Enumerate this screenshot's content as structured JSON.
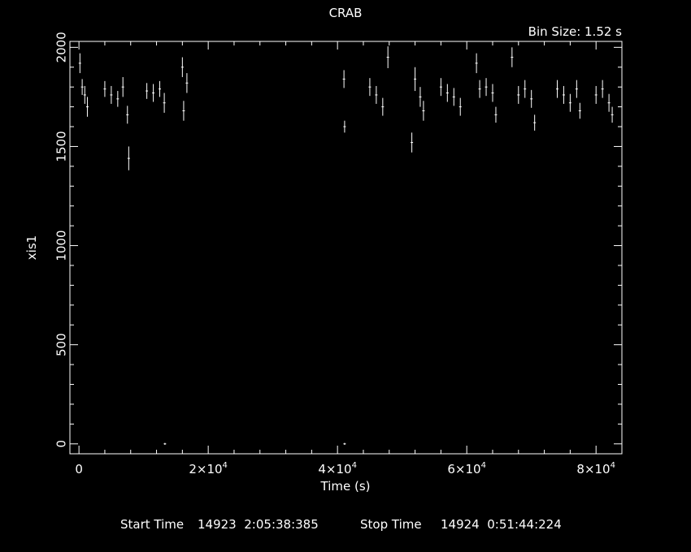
{
  "chart_data": {
    "type": "scatter",
    "title": "CRAB",
    "bin_size_label": "Bin Size: 1.52 s",
    "xlabel": "Time (s)",
    "ylabel": "xis1",
    "xlim": [
      -1400,
      84000
    ],
    "ylim": [
      -50,
      2030
    ],
    "y_ticks": [
      0,
      500,
      1000,
      1500,
      2000
    ],
    "x_tick_labels": [
      {
        "value": 0,
        "mantissa": "0",
        "exp": ""
      },
      {
        "value": 20000,
        "mantissa": "2×10",
        "exp": "4"
      },
      {
        "value": 40000,
        "mantissa": "4×10",
        "exp": "4"
      },
      {
        "value": 60000,
        "mantissa": "6×10",
        "exp": "4"
      },
      {
        "value": 80000,
        "mantissa": "8×10",
        "exp": "4"
      }
    ],
    "grid": false,
    "series": [
      {
        "color": "#ffffff",
        "marker": "errorbar",
        "points": [
          [
            150,
            1920,
            50
          ],
          [
            500,
            1800,
            40
          ],
          [
            900,
            1760,
            45
          ],
          [
            1300,
            1700,
            50
          ],
          [
            4000,
            1790,
            40
          ],
          [
            5000,
            1760,
            45
          ],
          [
            6000,
            1740,
            40
          ],
          [
            6800,
            1800,
            50
          ],
          [
            7500,
            1660,
            45
          ],
          [
            7700,
            1440,
            60
          ],
          [
            10500,
            1780,
            40
          ],
          [
            11500,
            1770,
            45
          ],
          [
            12500,
            1790,
            40
          ],
          [
            13200,
            1720,
            50
          ],
          [
            13300,
            0,
            5
          ],
          [
            16000,
            1900,
            50
          ],
          [
            16200,
            1680,
            50
          ],
          [
            16700,
            1820,
            50
          ],
          [
            41000,
            1840,
            45
          ],
          [
            41100,
            1600,
            30
          ],
          [
            41100,
            0,
            5
          ],
          [
            45000,
            1800,
            45
          ],
          [
            46000,
            1760,
            45
          ],
          [
            47000,
            1700,
            45
          ],
          [
            47800,
            1950,
            55
          ],
          [
            51500,
            1520,
            50
          ],
          [
            52000,
            1840,
            60
          ],
          [
            52800,
            1750,
            50
          ],
          [
            53300,
            1680,
            50
          ],
          [
            56000,
            1800,
            45
          ],
          [
            57000,
            1770,
            45
          ],
          [
            58000,
            1750,
            45
          ],
          [
            59000,
            1700,
            45
          ],
          [
            61500,
            1920,
            50
          ],
          [
            62000,
            1790,
            45
          ],
          [
            63000,
            1800,
            45
          ],
          [
            64000,
            1770,
            45
          ],
          [
            64500,
            1660,
            40
          ],
          [
            67000,
            1950,
            50
          ],
          [
            68000,
            1760,
            45
          ],
          [
            69000,
            1790,
            45
          ],
          [
            70000,
            1740,
            45
          ],
          [
            70500,
            1620,
            40
          ],
          [
            74000,
            1790,
            45
          ],
          [
            75000,
            1760,
            45
          ],
          [
            76000,
            1720,
            45
          ],
          [
            77000,
            1790,
            45
          ],
          [
            77500,
            1680,
            40
          ],
          [
            80000,
            1760,
            45
          ],
          [
            81000,
            1790,
            45
          ],
          [
            82000,
            1720,
            45
          ],
          [
            82500,
            1660,
            40
          ]
        ]
      }
    ]
  },
  "footer": {
    "start_label": "Start Time",
    "start_value": "14923  2:05:38:385",
    "stop_label": "Stop Time",
    "stop_value": "14924  0:51:44:224"
  }
}
